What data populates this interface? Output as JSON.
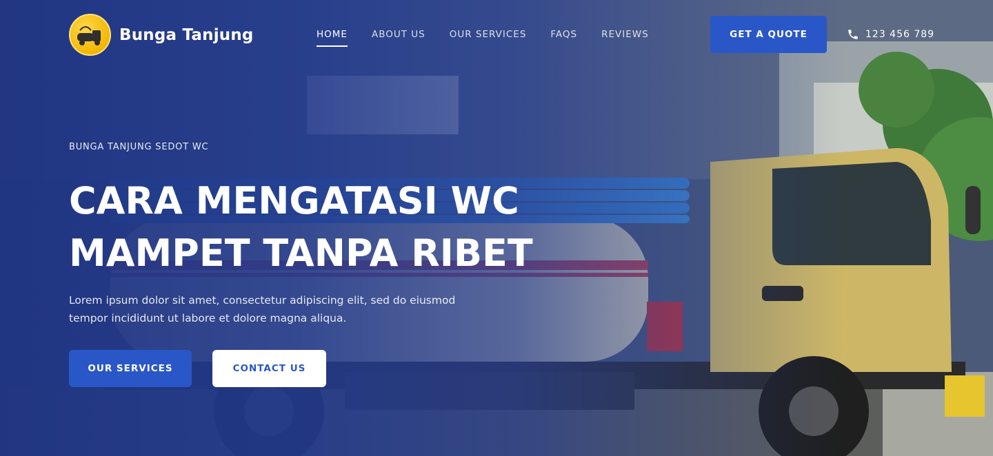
{
  "brand": {
    "name": "Bunga Tanjung",
    "logo_icon": "septic-truck-icon"
  },
  "nav": {
    "items": [
      {
        "label": "HOME",
        "active": true
      },
      {
        "label": "ABOUT US",
        "active": false
      },
      {
        "label": "OUR SERVICES",
        "active": false
      },
      {
        "label": "FAQS",
        "active": false
      },
      {
        "label": "REVIEWS",
        "active": false
      }
    ]
  },
  "header": {
    "cta_label": "GET A QUOTE",
    "phone_icon": "phone-icon",
    "phone_number": "123 456 789"
  },
  "hero": {
    "eyebrow": "BUNGA TANJUNG SEDOT WC",
    "title_line1": "CARA MENGATASI WC",
    "title_line2": "MAMPET TANPA RIBET",
    "description_line1": "Lorem ipsum dolor sit amet, consectetur adipiscing elit, sed do eiusmod",
    "description_line2": "tempor incididunt ut labore et dolore magna aliqua.",
    "primary_button": "OUR SERVICES",
    "secondary_button": "CONTACT US"
  },
  "colors": {
    "accent": "#2a57c8",
    "overlay": "#1f3482",
    "truck_body": "#c8b45a",
    "white": "#ffffff"
  }
}
